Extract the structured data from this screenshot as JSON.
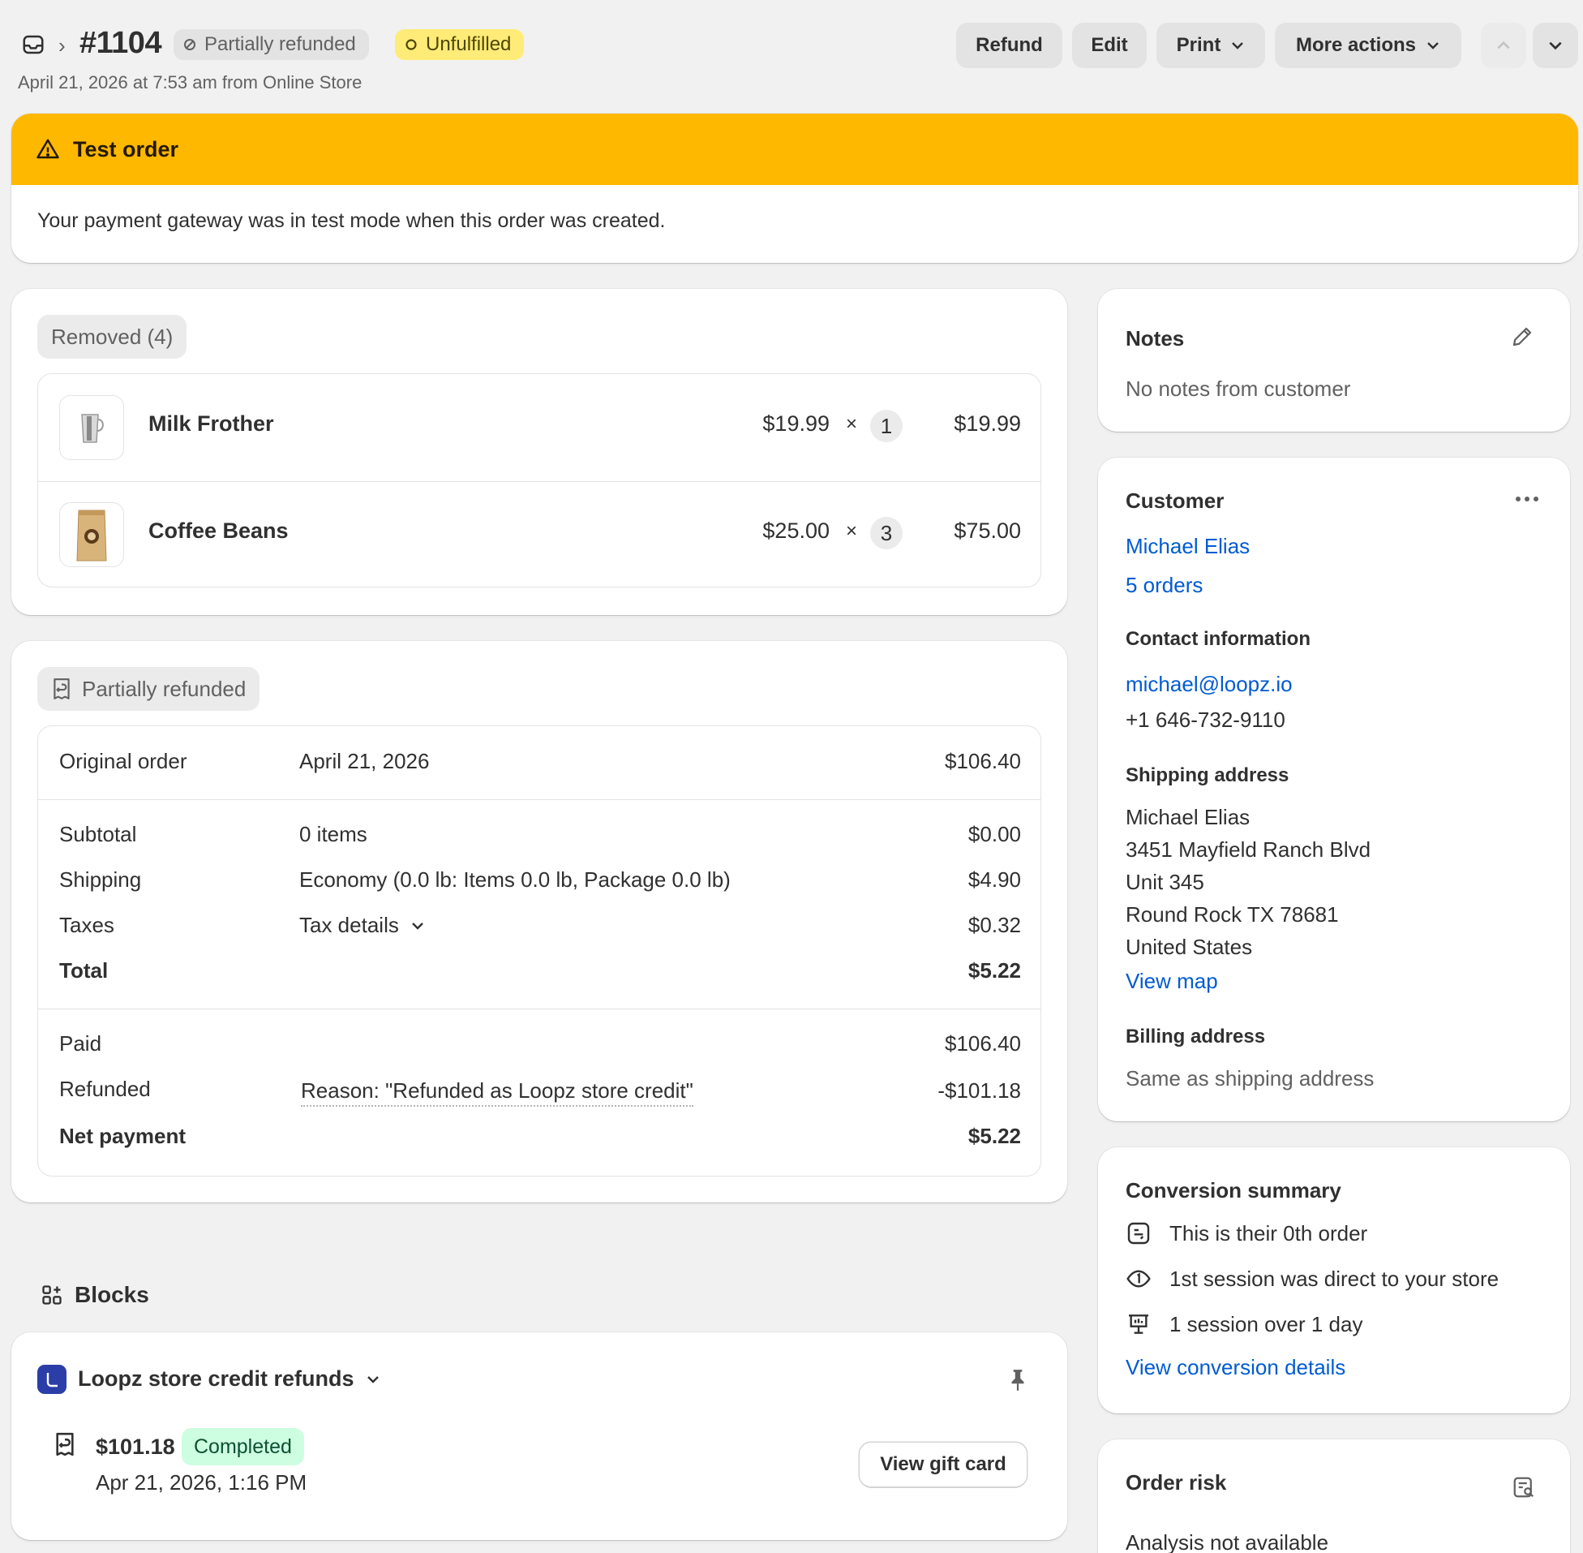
{
  "header": {
    "order_number": "#1104",
    "payment_status": "Partially refunded",
    "fulfillment_status": "Unfulfilled",
    "subtitle": "April 21, 2026 at 7:53 am from Online Store",
    "buttons": {
      "refund": "Refund",
      "edit": "Edit",
      "print": "Print",
      "more_actions": "More actions"
    }
  },
  "banner": {
    "title": "Test order",
    "body": "Your payment gateway was in test mode when this order was created."
  },
  "removed": {
    "label": "Removed (4)",
    "items": [
      {
        "name": "Milk Frother",
        "price": "$19.99",
        "times": "×",
        "qty": "1",
        "total": "$19.99"
      },
      {
        "name": "Coffee Beans",
        "price": "$25.00",
        "times": "×",
        "qty": "3",
        "total": "$75.00"
      }
    ]
  },
  "payment": {
    "label": "Partially refunded",
    "original_order": {
      "label": "Original order",
      "date": "April 21, 2026",
      "amount": "$106.40"
    },
    "subtotal": {
      "label": "Subtotal",
      "detail": "0 items",
      "amount": "$0.00"
    },
    "shipping": {
      "label": "Shipping",
      "detail": "Economy (0.0 lb: Items 0.0 lb, Package 0.0 lb)",
      "amount": "$4.90"
    },
    "taxes": {
      "label": "Taxes",
      "detail": "Tax details",
      "amount": "$0.32"
    },
    "total": {
      "label": "Total",
      "amount": "$5.22"
    },
    "paid": {
      "label": "Paid",
      "amount": "$106.40"
    },
    "refunded": {
      "label": "Refunded",
      "detail": "Reason: \"Refunded as Loopz store credit\"",
      "amount": "-$101.18"
    },
    "net": {
      "label": "Net payment",
      "amount": "$5.22"
    }
  },
  "blocks": {
    "title": "Blocks",
    "app_name": "Loopz store credit refunds",
    "credit_amount": "$101.18",
    "credit_status": "Completed",
    "credit_date": "Apr 21, 2026, 1:16 PM",
    "view_gift_card": "View gift card"
  },
  "notes": {
    "title": "Notes",
    "text": "No notes from customer"
  },
  "customer": {
    "title": "Customer",
    "name": "Michael Elias",
    "orders": "5 orders",
    "contact_title": "Contact information",
    "email": "michael@loopz.io",
    "phone": "+1 646-732-9110",
    "shipping_title": "Shipping address",
    "address": [
      "Michael Elias",
      "3451 Mayfield Ranch Blvd",
      "Unit 345",
      "Round Rock TX 78681",
      "United States"
    ],
    "view_map": "View map",
    "billing_title": "Billing address",
    "billing_text": "Same as shipping address"
  },
  "conversion": {
    "title": "Conversion summary",
    "rows": [
      "This is their 0th order",
      "1st session was direct to your store",
      "1 session over 1 day"
    ],
    "link": "View conversion details"
  },
  "risk": {
    "title": "Order risk",
    "text": "Analysis not available"
  }
}
